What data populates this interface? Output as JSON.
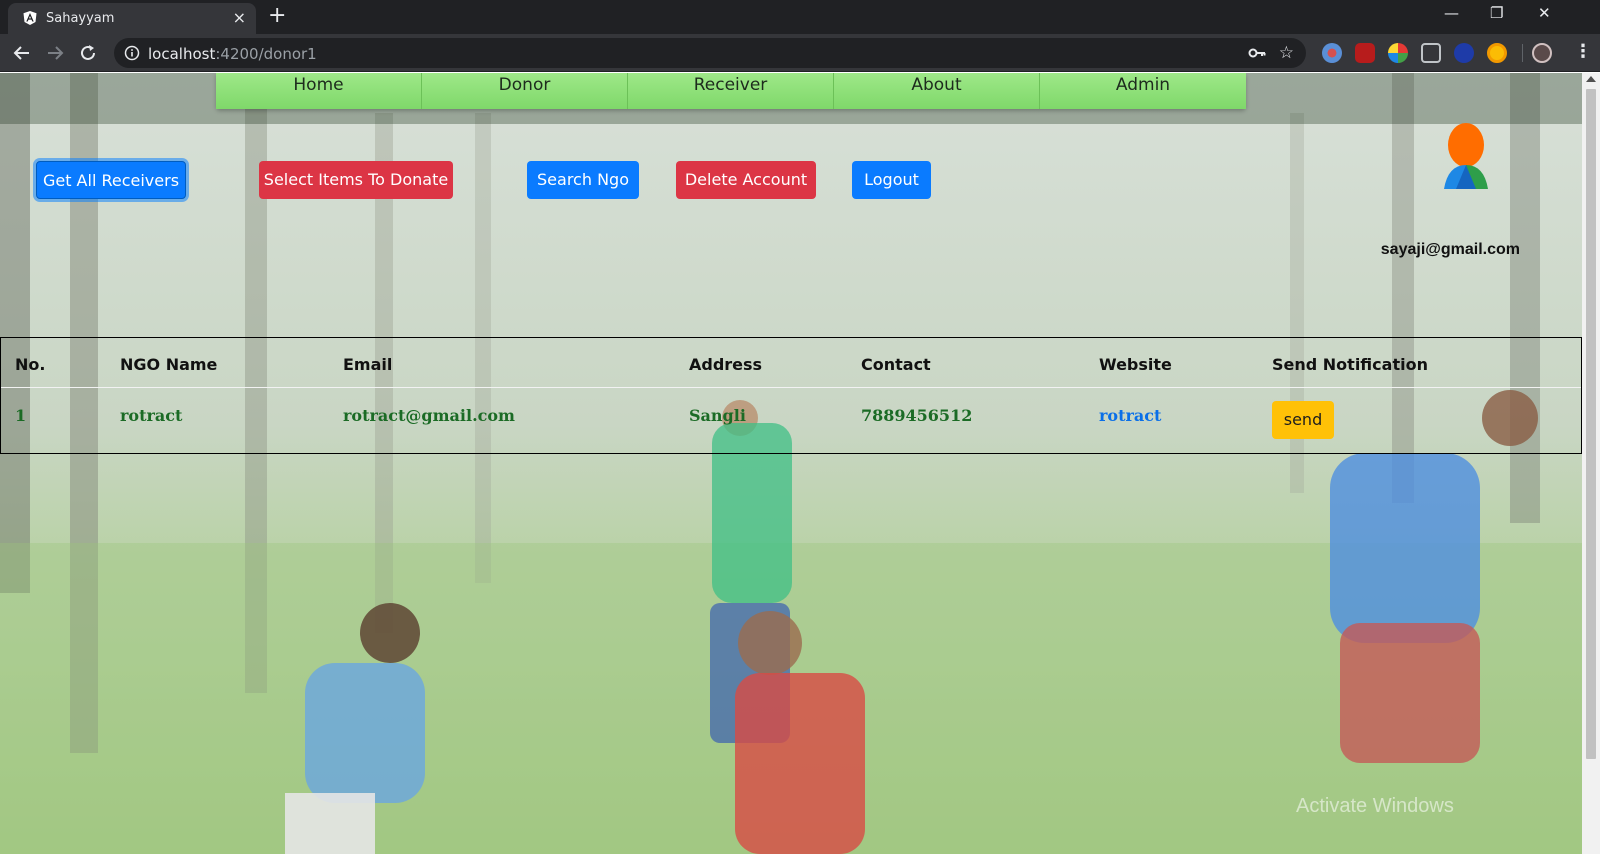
{
  "browser": {
    "tab_title": "Sahayyam",
    "tab_close": "×",
    "new_tab": "+",
    "url_host": "localhost",
    "url_path": ":4200/donor1",
    "window_controls": {
      "minimize": "—",
      "restore": "❐",
      "close": "✕"
    },
    "bookmark_icon": "star-icon",
    "menu": "⋮"
  },
  "nav": {
    "items": [
      {
        "label": "Home"
      },
      {
        "label": "Donor"
      },
      {
        "label": "Receiver"
      },
      {
        "label": "About"
      },
      {
        "label": "Admin"
      }
    ]
  },
  "actions": {
    "get_all_receivers": "Get All Receivers",
    "select_items": "Select Items To Donate",
    "search_ngo": "Search Ngo",
    "delete_account": "Delete Account",
    "logout": "Logout"
  },
  "user": {
    "email": "sayaji@gmail.com"
  },
  "table": {
    "headers": [
      "No.",
      "NGO Name",
      "Email",
      "Address",
      "Contact",
      "Website",
      "Send Notification"
    ],
    "rows": [
      {
        "no": "1",
        "name": "rotract",
        "email": "rotract@gmail.com",
        "address": "Sangli",
        "contact": "7889456512",
        "website": "rotract",
        "action": "send"
      }
    ]
  },
  "watermark": "Activate Windows",
  "colors": {
    "primary": "#0a7bff",
    "danger": "#dc3545",
    "warning": "#ffc107",
    "nav": "#8fe07a",
    "row_text": "#1b6b25"
  }
}
